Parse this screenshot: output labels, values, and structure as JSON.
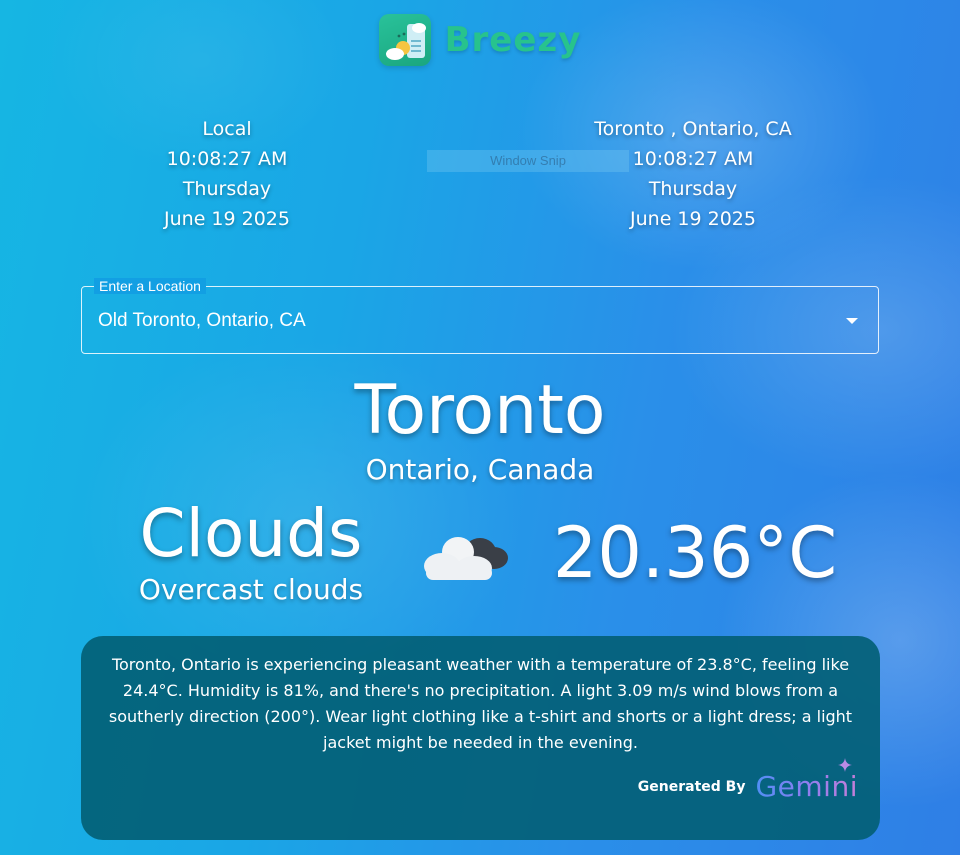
{
  "app": {
    "name": "Breezy",
    "icon": "weather-app-logo-icon",
    "brand_color": "#27c38d"
  },
  "local_clock": {
    "label": "Local",
    "time": "10:08:27 AM",
    "weekday": "Thursday",
    "date": "June 19 2025"
  },
  "remote_clock": {
    "label": "Toronto , Ontario, CA",
    "time": "10:08:27 AM",
    "weekday": "Thursday",
    "date": "June 19 2025"
  },
  "overlay": {
    "snip_label": "Window Snip"
  },
  "location": {
    "label": "Enter a Location",
    "value": "Old Toronto, Ontario, CA",
    "dropdown_icon": "caret-down-icon"
  },
  "weather": {
    "city": "Toronto",
    "region": "Ontario, Canada",
    "condition": "Clouds",
    "description": "Overcast clouds",
    "icon": "overcast-clouds-icon",
    "temperature": "20.36°C"
  },
  "summary": {
    "text": "Toronto, Ontario is experiencing pleasant weather with a temperature of 23.8°C, feeling like 24.4°C. Humidity is 81%, and there's no precipitation. A light 3.09 m/s wind blows from a southerly direction (200°). Wear light clothing like a t-shirt and shorts or a light dress; a light jacket might be needed in the evening.",
    "generated_by": "Generated By",
    "provider": "Gemini",
    "card_color": "#035f76"
  }
}
